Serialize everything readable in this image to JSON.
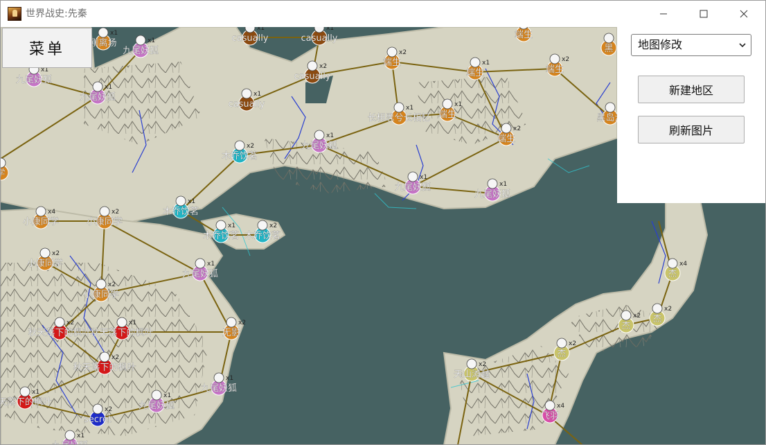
{
  "window": {
    "title": "世界战史:先秦",
    "icon": "portrait-app-icon"
  },
  "menu": {
    "label": "菜单"
  },
  "panel": {
    "mode_selected": "地图修改",
    "new_region_label": "新建地区",
    "refresh_label": "刷新图片"
  },
  "colors": {
    "sea": "#466262",
    "land": "#d6d4c2",
    "road": "#7a6310",
    "river": "#2a3fd0",
    "faction_purple": "#c674c6",
    "faction_orange": "#d5841e",
    "faction_brown": "#8b4a10",
    "faction_cyan": "#22b4c4",
    "faction_red": "#d41818",
    "faction_blue": "#1e2cc8",
    "faction_yellow": "#c9c46a",
    "faction_magenta": "#d84ea8"
  },
  "map": {
    "units": [
      {
        "label": "九尾妖狐",
        "count": "x1",
        "color": "#c674c6"
      },
      {
        "label": "九尾妖狐",
        "count": "x1",
        "color": "#c674c6"
      },
      {
        "label": "九尾妖狐",
        "count": "x1",
        "color": "#c674c6"
      },
      {
        "label": "casually",
        "count": "x1",
        "color": "#8b4a10"
      },
      {
        "label": "casually",
        "count": "x1",
        "color": "#8b4a10"
      },
      {
        "label": "casually",
        "count": "x2",
        "color": "#8b4a10"
      },
      {
        "label": "casually",
        "count": "x1",
        "color": "#8b4a10"
      },
      {
        "label": "端生",
        "count": "x2",
        "color": "#d5841e"
      },
      {
        "label": "端生",
        "count": "x1",
        "color": "#d5841e"
      },
      {
        "label": "端生",
        "count": "x1",
        "color": "#d5841e"
      },
      {
        "label": "端生",
        "count": "x2",
        "color": "#d5841e"
      },
      {
        "label": "端生",
        "count": "x1",
        "color": "#d5841e"
      },
      {
        "label": "端生",
        "count": "x2",
        "color": "#d5841e"
      },
      {
        "label": "长相思兮长相忆",
        "count": "x1",
        "color": "#d5841e"
      },
      {
        "label": "九尾妖狐",
        "count": "x1",
        "color": "#c674c6"
      },
      {
        "label": "九尾妖狐",
        "count": "x1",
        "color": "#c674c6"
      },
      {
        "label": "九尾妖狐",
        "count": "x1",
        "color": "#c674c6"
      },
      {
        "label": "木乔饮茗",
        "count": "x2",
        "color": "#22b4c4"
      },
      {
        "label": "木乔饮茗",
        "count": "x1",
        "color": "#22b4c4"
      },
      {
        "label": "木乔饮茗",
        "count": "x1",
        "color": "#22b4c4"
      },
      {
        "label": "木乔饮茗",
        "count": "x2",
        "color": "#22b4c4"
      },
      {
        "label": "小康同学",
        "count": "x4",
        "color": "#d5841e"
      },
      {
        "label": "小康同学",
        "count": "x2",
        "color": "#d5841e"
      },
      {
        "label": "小康同学",
        "count": "x2",
        "color": "#d5841e"
      },
      {
        "label": "小康同学",
        "count": "x2",
        "color": "#d5841e"
      },
      {
        "label": "九尾妖狐",
        "count": "x1",
        "color": "#c674c6"
      },
      {
        "label": "无影",
        "count": "x2",
        "color": "#d5841e"
      },
      {
        "label": "秋天落下的枫叶",
        "count": "x2",
        "color": "#d41818"
      },
      {
        "label": "秋天落下的枫叶",
        "count": "x1",
        "color": "#d41818"
      },
      {
        "label": "秋天落下的枫叶",
        "count": "x2",
        "color": "#d41818"
      },
      {
        "label": "天落下的枫叶",
        "count": "x1",
        "color": "#d41818"
      },
      {
        "label": "secret",
        "count": "x2",
        "color": "#1e2cc8"
      },
      {
        "label": "九尾妖狐",
        "count": "x1",
        "color": "#c674c6"
      },
      {
        "label": "九尾妖狐",
        "count": "x1",
        "color": "#c674c6"
      },
      {
        "label": "九尾妖狐",
        "count": "x1",
        "color": "#c674c6"
      },
      {
        "label": "杰",
        "count": "x4",
        "color": "#c9c46a"
      },
      {
        "label": "杰",
        "count": "x2",
        "color": "#c9c46a"
      },
      {
        "label": "杰",
        "count": "x2",
        "color": "#c9c46a"
      },
      {
        "label": "杰",
        "count": "x2",
        "color": "#c9c46a"
      },
      {
        "label": "天山滩越",
        "count": "x2",
        "color": "#c9c46a"
      },
      {
        "label": "飞羽",
        "count": "x4",
        "color": "#d84ea8"
      },
      {
        "label": "学",
        "count": "",
        "color": "#d5841e"
      },
      {
        "label": "黑",
        "count": "",
        "color": "#d5841e"
      },
      {
        "label": "黑岛汐",
        "count": "",
        "color": "#d5841e"
      },
      {
        "label": "刚离场",
        "count": "x1",
        "color": "#d5841e"
      }
    ]
  }
}
